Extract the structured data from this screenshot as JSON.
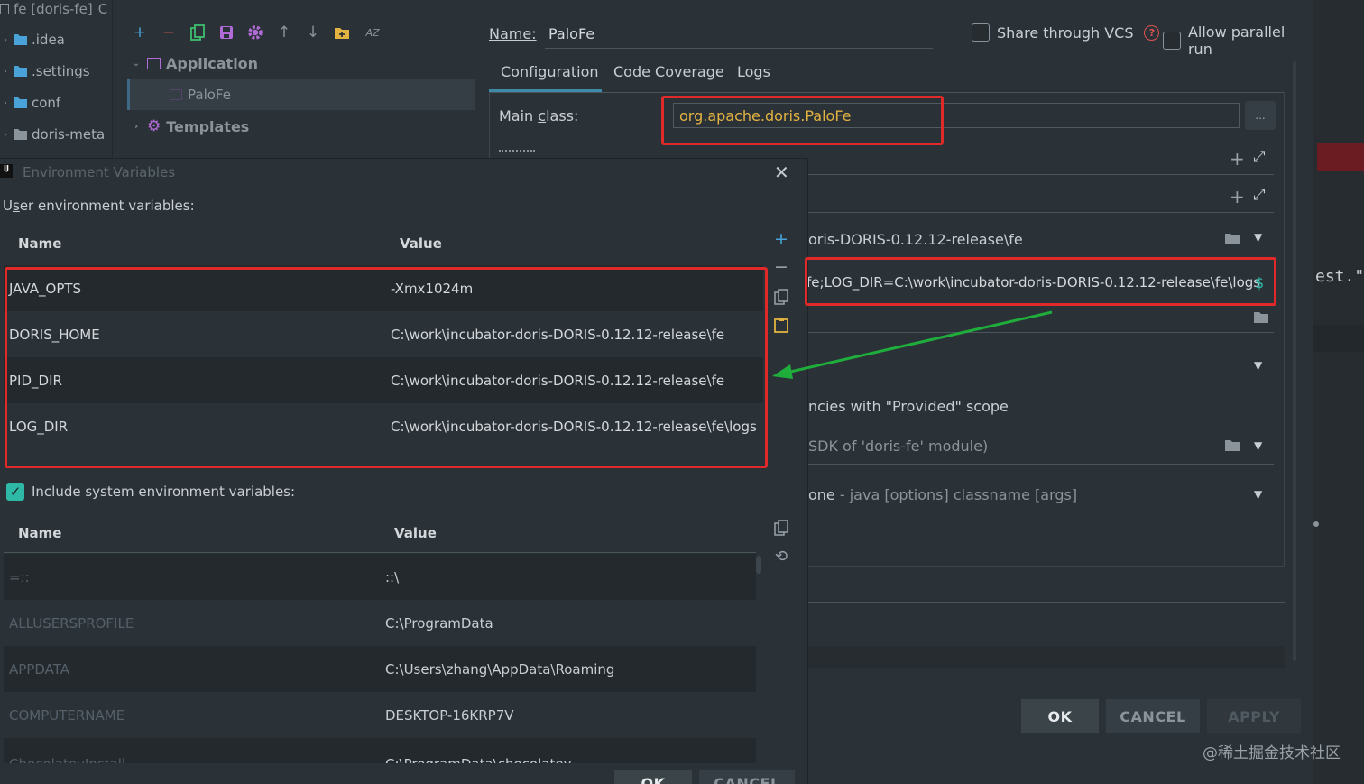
{
  "project_tree": {
    "root": "fe [doris-fe]",
    "root_suffix": "C",
    "items": [
      {
        "label": ".idea",
        "color": "#4aa3d8"
      },
      {
        "label": ".settings",
        "color": "#4aa3d8"
      },
      {
        "label": "conf",
        "color": "#4aa3d8"
      },
      {
        "label": "doris-meta",
        "color": "#8b949b"
      }
    ]
  },
  "config_list": {
    "toolbar": [
      "add-icon",
      "remove-icon",
      "copy-icon",
      "save-icon",
      "gear-icon",
      "arrow-up-icon",
      "arrow-down-icon",
      "new-folder-icon",
      "sort-az-icon"
    ],
    "sort_label": "AZ",
    "application": "Application",
    "palofe": "PaloFe",
    "templates": "Templates"
  },
  "config": {
    "name_label": "Name:",
    "name_value": "PaloFe",
    "share_label": "Share through VCS",
    "parallel_label": "Allow parallel run",
    "tabs": [
      "Configuration",
      "Code Coverage",
      "Logs"
    ],
    "main_class_label": "Main class:",
    "main_class_value": "org.apache.doris.PaloFe",
    "browse_label": "...",
    "workdir_value": "oris-DORIS-0.12.12-release\\fe",
    "env_value": "fe;LOG_DIR=C:\\work\\incubator-doris-DORIS-0.12.12-release\\fe\\logs",
    "env_symbol": "$",
    "provided_text": "ncies with \"Provided\" scope",
    "jre_text": "SDK of 'doris-fe' module)",
    "shorten_value": "one",
    "shorten_hint": " - java [options] classname [args]",
    "ok": "OK",
    "cancel": "CANCEL",
    "apply": "APPLY"
  },
  "editor": {
    "snippet": "est.\""
  },
  "env_dialog": {
    "title": "Environment Variables",
    "user_label": "User environment variables:",
    "col_name": "Name",
    "col_value": "Value",
    "user_vars": [
      {
        "name": "JAVA_OPTS",
        "value": "-Xmx1024m"
      },
      {
        "name": "DORIS_HOME",
        "value": "C:\\work\\incubator-doris-DORIS-0.12.12-release\\fe"
      },
      {
        "name": "PID_DIR",
        "value": "C:\\work\\incubator-doris-DORIS-0.12.12-release\\fe"
      },
      {
        "name": "LOG_DIR",
        "value": "C:\\work\\incubator-doris-DORIS-0.12.12-release\\fe\\logs"
      }
    ],
    "include_system_label": "Include system environment variables:",
    "system_vars": [
      {
        "name": "=::",
        "value": "::\\"
      },
      {
        "name": "ALLUSERSPROFILE",
        "value": "C:\\ProgramData"
      },
      {
        "name": "APPDATA",
        "value": "C:\\Users\\zhang\\AppData\\Roaming"
      },
      {
        "name": "COMPUTERNAME",
        "value": "DESKTOP-16KRP7V"
      },
      {
        "name": "ChocolateyInstall",
        "value": "C:\\ProgramData\\chocolatey"
      }
    ],
    "ok": "OK",
    "cancel": "CANCEL"
  },
  "watermark": "@稀土掘金技术社区",
  "colors": {
    "accent": "#4aa3d8",
    "highlight": "#e02a2a",
    "arrow": "#1fae3b",
    "main_class_text": "#e3b341",
    "checkbox_on": "#2eb8a6"
  }
}
